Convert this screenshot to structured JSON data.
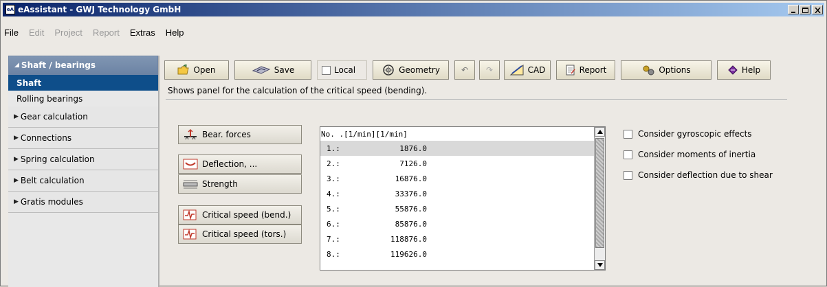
{
  "window": {
    "title": "eAssistant - GWJ Technology GmbH",
    "app_icon_text": "eA"
  },
  "menu": [
    {
      "label": "File",
      "enabled": true
    },
    {
      "label": "Edit",
      "enabled": false
    },
    {
      "label": "Project",
      "enabled": false
    },
    {
      "label": "Report",
      "enabled": false
    },
    {
      "label": "Extras",
      "enabled": true
    },
    {
      "label": "Help",
      "enabled": true
    }
  ],
  "sidebar": {
    "header": "Shaft / bearings",
    "sub_items": [
      "Shaft",
      "Rolling bearings"
    ],
    "selected_sub": "Shaft",
    "groups": [
      "Gear calculation",
      "Connections",
      "Spring calculation",
      "Belt calculation",
      "Gratis modules"
    ]
  },
  "toolbar": {
    "open": "Open",
    "save": "Save",
    "local": "Local",
    "geometry": "Geometry",
    "cad": "CAD",
    "report": "Report",
    "options": "Options",
    "help": "Help"
  },
  "hint": "Shows panel for the calculation of the critical speed (bending).",
  "panel_buttons": [
    "Bear. forces",
    "Deflection, ...",
    "Strength",
    "Critical speed (bend.)",
    "Critical speed (tors.)"
  ],
  "results": {
    "header": "No.  .[1/min][1/min]",
    "rows": [
      {
        "no": "1.:",
        "value": "1876.0"
      },
      {
        "no": "2.:",
        "value": "7126.0"
      },
      {
        "no": "3.:",
        "value": "16876.0"
      },
      {
        "no": "4.:",
        "value": "33376.0"
      },
      {
        "no": "5.:",
        "value": "55876.0"
      },
      {
        "no": "6.:",
        "value": "85876.0"
      },
      {
        "no": "7.:",
        "value": "118876.0"
      },
      {
        "no": "8.:",
        "value": "119626.0"
      }
    ],
    "selected_index": 0
  },
  "options": [
    {
      "label": "Consider gyroscopic effects",
      "checked": false
    },
    {
      "label": "Consider moments of inertia",
      "checked": false
    },
    {
      "label": "Consider deflection due to shear",
      "checked": false
    }
  ]
}
